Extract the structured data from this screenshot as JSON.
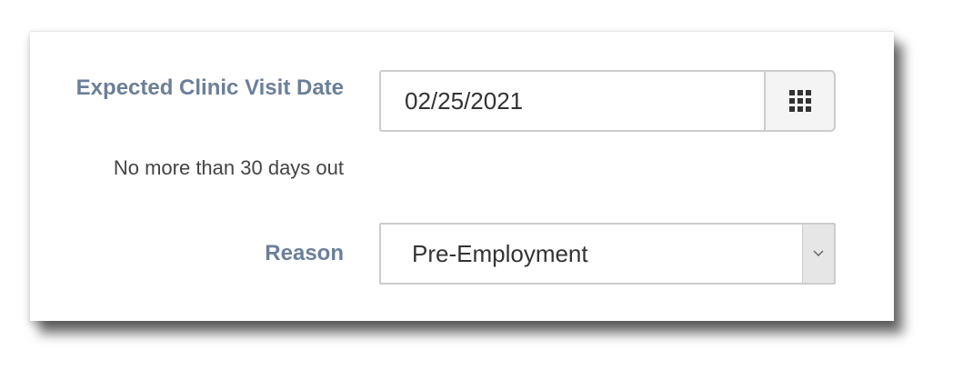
{
  "form": {
    "date_label": "Expected Clinic Visit Date",
    "date_hint": "No more than 30 days out",
    "date_value": "02/25/2021",
    "calendar_icon": "calendar-grid-icon",
    "reason_label": "Reason",
    "reason_selected": "Pre-Employment",
    "dropdown_icon": "chevron-down-icon"
  },
  "colors": {
    "label": "#6b7f99",
    "hint": "#444444",
    "input_border": "#cccccc",
    "button_bg": "#f4f4f4",
    "arrow_bg": "#e6e6e6"
  }
}
